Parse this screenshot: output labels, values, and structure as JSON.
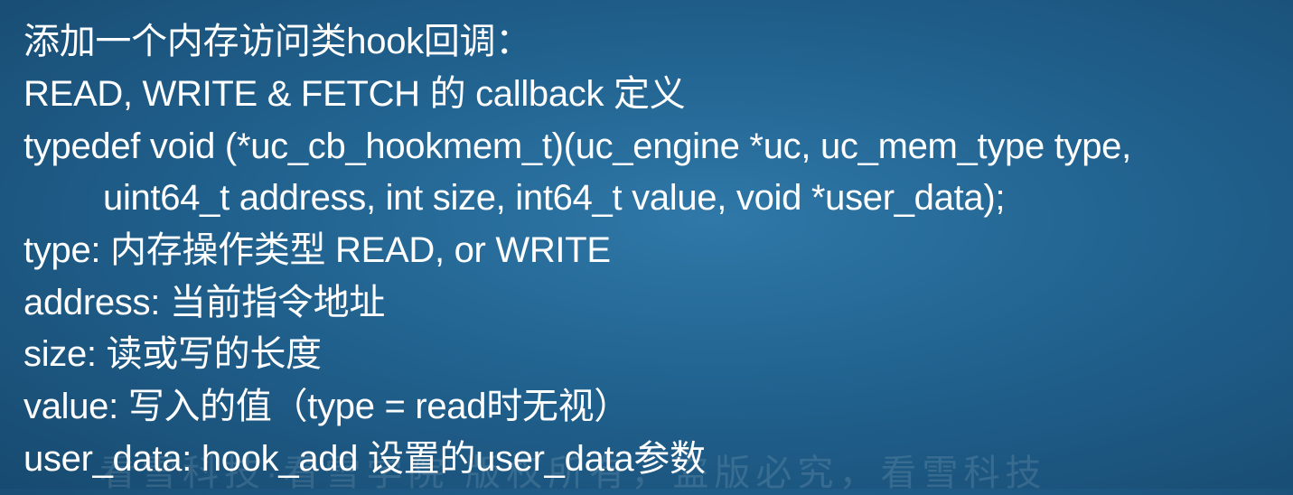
{
  "slide": {
    "lines": [
      "添加一个内存访问类hook回调：",
      "READ, WRITE & FETCH 的 callback 定义",
      "typedef void (*uc_cb_hookmem_t)(uc_engine *uc, uc_mem_type type,",
      "uint64_t address, int size, int64_t value, void *user_data);",
      "type: 内存操作类型 READ, or WRITE",
      "address: 当前指令地址",
      "size: 读或写的长度",
      "value: 写入的值（type = read时无视）",
      "user_data: hook_add 设置的user_data参数"
    ],
    "watermark": "看雪科技·看雪学院 版权所有，盗版必究，看雪科技"
  }
}
